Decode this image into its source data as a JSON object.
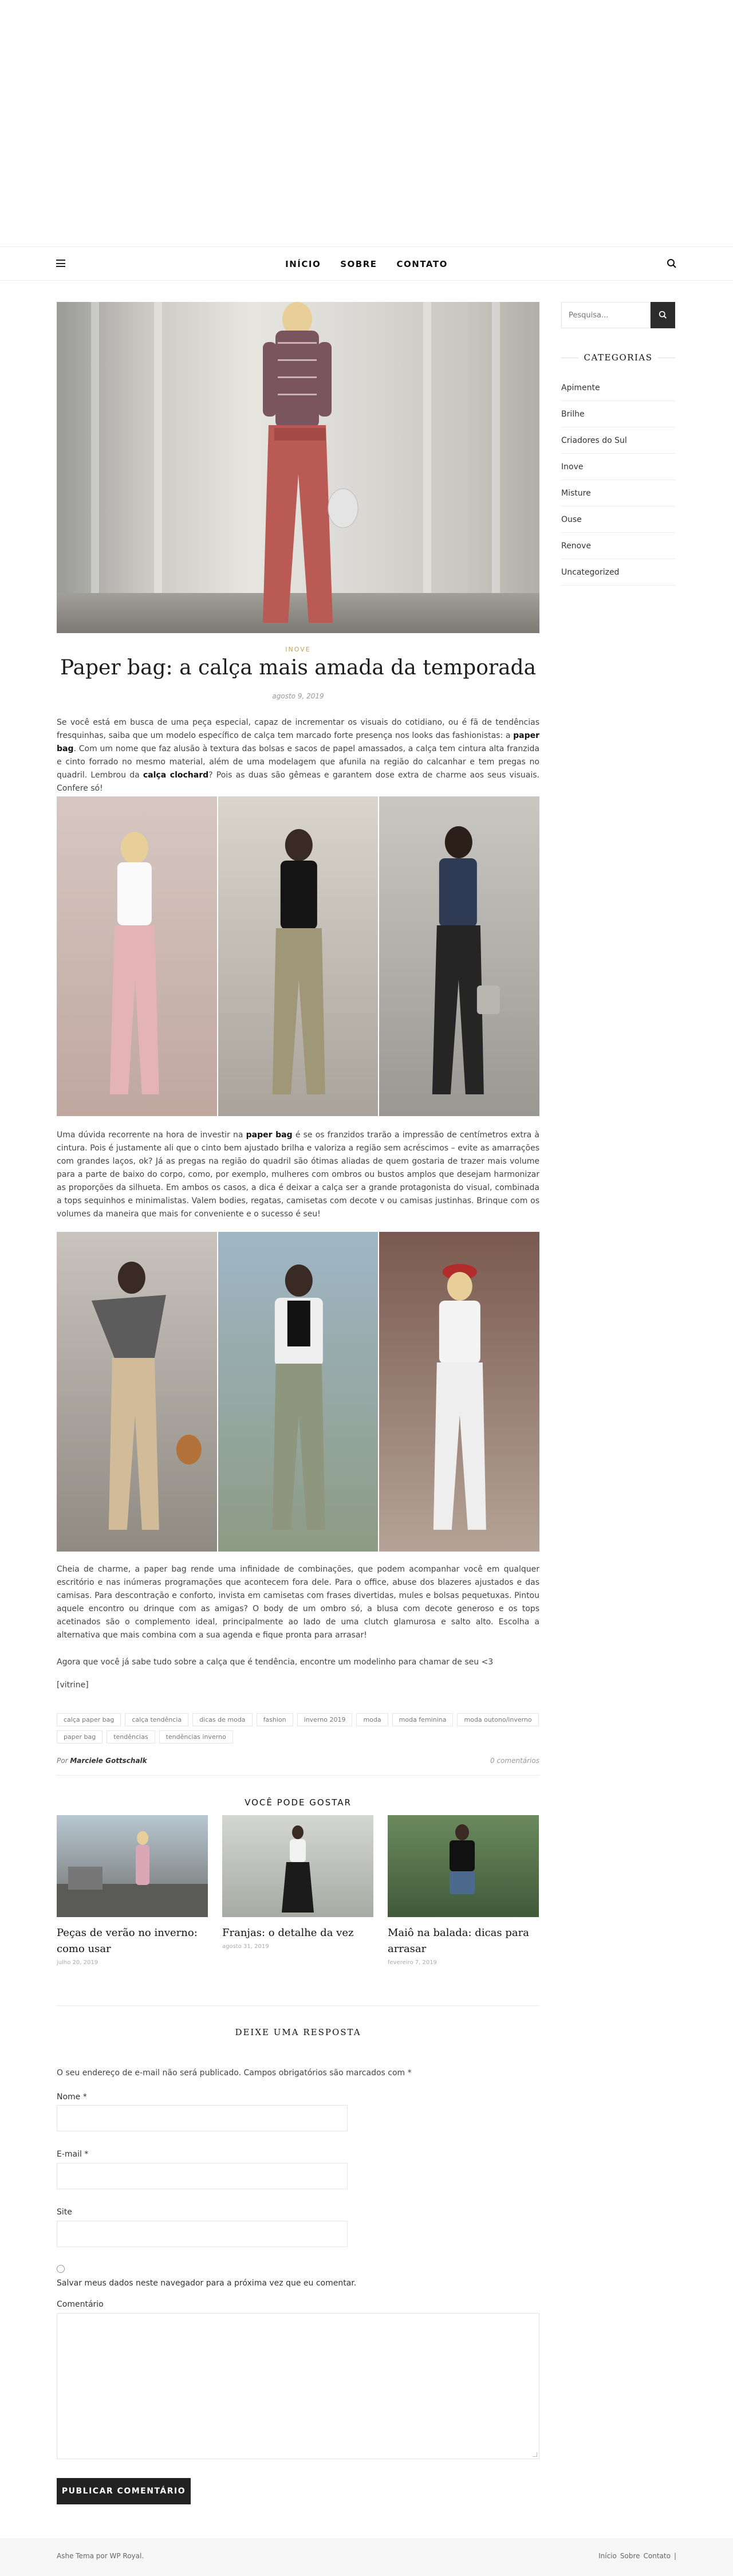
{
  "nav": {
    "items": [
      "Início",
      "Sobre",
      "Contato"
    ]
  },
  "post": {
    "category": "Inove",
    "title": "Paper bag: a calça mais amada da temporada",
    "date": "agosto 9, 2019",
    "intro_a": "Se você está em busca de uma peça especial, capaz de incrementar os visuais do cotidiano, ou é fã de tendências fresquinhas, saiba que um modelo específico de calça tem marcado forte presença nos looks das fashionistas: a ",
    "intro_b": "paper bag",
    "intro_c": ". Com um nome que faz alusão à textura das bolsas e sacos de papel amassados, a calça tem cintura alta franzida e cinto forrado no mesmo material, além de uma modelagem que afunila na região do calcanhar e tem pregas no quadril. Lembrou da ",
    "intro_d": "calça clochard",
    "intro_e": "? Pois as duas são gêmeas e garantem dose extra de charme aos seus visuais. Confere só!",
    "body2_a": "Uma dúvida recorrente na hora de investir na ",
    "body2_b": "paper bag",
    "body2_c": " é se os franzidos trarão a impressão de centímetros extra à cintura. Pois é justamente ali que o cinto bem ajustado brilha e valoriza a região sem acréscimos – evite as amarrações com grandes laços, ok? Já as pregas na região do quadril são ótimas aliadas de quem gostaria de trazer mais volume para a parte de baixo do corpo, como, por exemplo, mulheres com ombros ou bustos amplos que desejam harmonizar as proporções da silhueta. Em ambos os casos, a dica é deixar a calça ser a grande protagonista do visual, combinada a tops sequinhos e minimalistas. Valem bodies, regatas, camisetas com decote v ou camisas justinhas. Brinque com os volumes da maneira que mais for conveniente e o sucesso é seu!",
    "body3": "Cheia de charme, a paper bag rende uma infinidade de combinações, que podem acompanhar você em qualquer escritório e nas inúmeras programações que acontecem fora dele. Para o office, abuse dos blazeres ajustados e das camisas. Para descontração e conforto, invista em camisetas com frases divertidas, mules e bolsas pequetuxas. Pintou aquele encontro ou drinque com as amigas? O body de um ombro só, a blusa com decote generoso e os tops acetinados são o complemento ideal, principalmente ao lado de uma clutch glamurosa e salto alto. Escolha a alternativa que mais combina com a sua agenda e fique pronta para arrasar!",
    "body4": "Agora que você já sabe tudo sobre a calça que é tendência, encontre um modelinho para chamar de seu <3",
    "body5": "[vitrine]",
    "tags": [
      "calça paper bag",
      "calça tendência",
      "dicas de moda",
      "fashion",
      "inverno 2019",
      "moda",
      "moda feminina",
      "moda outono/inverno",
      "paper bag",
      "tendências",
      "tendências inverno"
    ],
    "byline_prefix": "Por",
    "author": "Marciele Gottschalk",
    "comments": "0 comentários"
  },
  "related": {
    "heading": "Você pode gostar",
    "items": [
      {
        "title": "Peças de verão no inverno: como usar",
        "date": "julho 20, 2019"
      },
      {
        "title": "Franjas: o detalhe da vez",
        "date": "agosto 31, 2019"
      },
      {
        "title": "Maiô na balada: dicas para arrasar",
        "date": "fevereiro 7, 2019"
      }
    ]
  },
  "reply": {
    "heading": "Deixe uma resposta",
    "note": "O seu endereço de e-mail não será publicado. Campos obrigatórios são marcados com *",
    "name_label": "Nome *",
    "email_label": "E-mail *",
    "site_label": "Site",
    "save_label": "Salvar meus dados neste navegador para a próxima vez que eu comentar.",
    "comment_label": "Comentário",
    "submit": "Publicar comentário"
  },
  "sidebar": {
    "search_placeholder": "Pesquisa...",
    "categories_title": "Categorias",
    "categories": [
      "Apimente",
      "Brilhe",
      "Criadores do Sul",
      "Inove",
      "Misture",
      "Ouse",
      "Renove",
      "Uncategorized"
    ]
  },
  "footer": {
    "credit": "Ashe Tema por WP Royal.",
    "links": [
      "Início",
      "Sobre",
      "Contato"
    ],
    "separator": "|"
  },
  "colors": {
    "accent": "#c9a14a",
    "dark": "#222222",
    "border": "#e5e5e5"
  }
}
